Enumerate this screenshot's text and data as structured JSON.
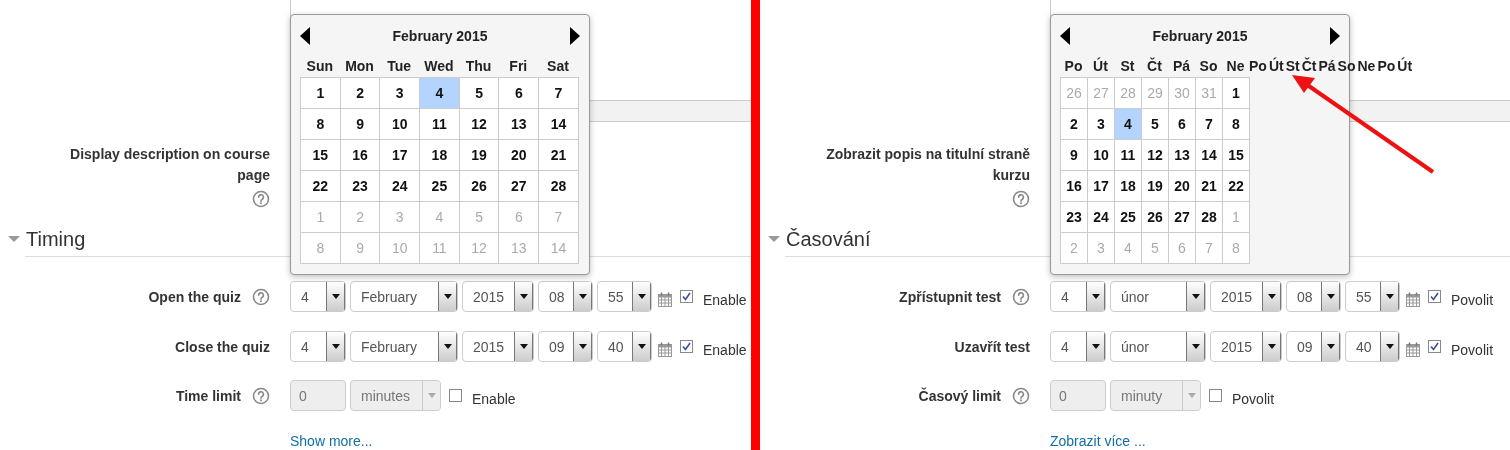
{
  "panels": [
    {
      "calendar": {
        "title": "February 2015",
        "weekdays": [
          "Sun",
          "Mon",
          "Tue",
          "Wed",
          "Thu",
          "Fri",
          "Sat"
        ],
        "weeks": [
          [
            {
              "day": "1",
              "current": true,
              "selected": false
            },
            {
              "day": "2",
              "current": true,
              "selected": false
            },
            {
              "day": "3",
              "current": true,
              "selected": false
            },
            {
              "day": "4",
              "current": true,
              "selected": true
            },
            {
              "day": "5",
              "current": true,
              "selected": false
            },
            {
              "day": "6",
              "current": true,
              "selected": false
            },
            {
              "day": "7",
              "current": true,
              "selected": false
            }
          ],
          [
            {
              "day": "8",
              "current": true,
              "selected": false
            },
            {
              "day": "9",
              "current": true,
              "selected": false
            },
            {
              "day": "10",
              "current": true,
              "selected": false
            },
            {
              "day": "11",
              "current": true,
              "selected": false
            },
            {
              "day": "12",
              "current": true,
              "selected": false
            },
            {
              "day": "13",
              "current": true,
              "selected": false
            },
            {
              "day": "14",
              "current": true,
              "selected": false
            }
          ],
          [
            {
              "day": "15",
              "current": true,
              "selected": false
            },
            {
              "day": "16",
              "current": true,
              "selected": false
            },
            {
              "day": "17",
              "current": true,
              "selected": false
            },
            {
              "day": "18",
              "current": true,
              "selected": false
            },
            {
              "day": "19",
              "current": true,
              "selected": false
            },
            {
              "day": "20",
              "current": true,
              "selected": false
            },
            {
              "day": "21",
              "current": true,
              "selected": false
            }
          ],
          [
            {
              "day": "22",
              "current": true,
              "selected": false
            },
            {
              "day": "23",
              "current": true,
              "selected": false
            },
            {
              "day": "24",
              "current": true,
              "selected": false
            },
            {
              "day": "25",
              "current": true,
              "selected": false
            },
            {
              "day": "26",
              "current": true,
              "selected": false
            },
            {
              "day": "27",
              "current": true,
              "selected": false
            },
            {
              "day": "28",
              "current": true,
              "selected": false
            }
          ],
          [
            {
              "day": "1",
              "current": false,
              "selected": false
            },
            {
              "day": "2",
              "current": false,
              "selected": false
            },
            {
              "day": "3",
              "current": false,
              "selected": false
            },
            {
              "day": "4",
              "current": false,
              "selected": false
            },
            {
              "day": "5",
              "current": false,
              "selected": false
            },
            {
              "day": "6",
              "current": false,
              "selected": false
            },
            {
              "day": "7",
              "current": false,
              "selected": false
            }
          ],
          [
            {
              "day": "8",
              "current": false,
              "selected": false
            },
            {
              "day": "9",
              "current": false,
              "selected": false
            },
            {
              "day": "10",
              "current": false,
              "selected": false
            },
            {
              "day": "11",
              "current": false,
              "selected": false
            },
            {
              "day": "12",
              "current": false,
              "selected": false
            },
            {
              "day": "13",
              "current": false,
              "selected": false
            },
            {
              "day": "14",
              "current": false,
              "selected": false
            }
          ]
        ]
      },
      "description_label": "Display description on course page",
      "section": {
        "title": "Timing",
        "expanded": true
      },
      "date_rows": [
        {
          "label": "Open the quiz",
          "help": true,
          "day": "4",
          "month": "February",
          "year": "2015",
          "hour": "08",
          "minute": "55",
          "enabled": true,
          "enable_label": "Enable"
        },
        {
          "label": "Close the quiz",
          "day": "4",
          "month": "February",
          "year": "2015",
          "hour": "09",
          "minute": "40",
          "enabled": true,
          "enable_label": "Enable"
        }
      ],
      "time_limit": {
        "label": "Time limit",
        "help": true,
        "value": "0",
        "unit": "minutes",
        "enabled": false,
        "enable_label": "Enable"
      },
      "show_more": "Show more..."
    },
    {
      "arrow": true,
      "calendar": {
        "title": "February 2015",
        "weekdays": [
          "Po",
          "Út",
          "St",
          "Čt",
          "Pá",
          "So",
          "Ne"
        ],
        "overflow_weekdays": [
          "Po",
          "Út",
          "St",
          "Čt",
          "Pá",
          "So",
          "Ne",
          "Po",
          "Út"
        ],
        "weeks": [
          [
            {
              "day": "26",
              "current": false,
              "selected": false
            },
            {
              "day": "27",
              "current": false,
              "selected": false
            },
            {
              "day": "28",
              "current": false,
              "selected": false
            },
            {
              "day": "29",
              "current": false,
              "selected": false
            },
            {
              "day": "30",
              "current": false,
              "selected": false
            },
            {
              "day": "31",
              "current": false,
              "selected": false
            },
            {
              "day": "1",
              "current": true,
              "selected": false
            }
          ],
          [
            {
              "day": "2",
              "current": true,
              "selected": false
            },
            {
              "day": "3",
              "current": true,
              "selected": false
            },
            {
              "day": "4",
              "current": true,
              "selected": true
            },
            {
              "day": "5",
              "current": true,
              "selected": false
            },
            {
              "day": "6",
              "current": true,
              "selected": false
            },
            {
              "day": "7",
              "current": true,
              "selected": false
            },
            {
              "day": "8",
              "current": true,
              "selected": false
            }
          ],
          [
            {
              "day": "9",
              "current": true,
              "selected": false
            },
            {
              "day": "10",
              "current": true,
              "selected": false
            },
            {
              "day": "11",
              "current": true,
              "selected": false
            },
            {
              "day": "12",
              "current": true,
              "selected": false
            },
            {
              "day": "13",
              "current": true,
              "selected": false
            },
            {
              "day": "14",
              "current": true,
              "selected": false
            },
            {
              "day": "15",
              "current": true,
              "selected": false
            }
          ],
          [
            {
              "day": "16",
              "current": true,
              "selected": false
            },
            {
              "day": "17",
              "current": true,
              "selected": false
            },
            {
              "day": "18",
              "current": true,
              "selected": false
            },
            {
              "day": "19",
              "current": true,
              "selected": false
            },
            {
              "day": "20",
              "current": true,
              "selected": false
            },
            {
              "day": "21",
              "current": true,
              "selected": false
            },
            {
              "day": "22",
              "current": true,
              "selected": false
            }
          ],
          [
            {
              "day": "23",
              "current": true,
              "selected": false
            },
            {
              "day": "24",
              "current": true,
              "selected": false
            },
            {
              "day": "25",
              "current": true,
              "selected": false
            },
            {
              "day": "26",
              "current": true,
              "selected": false
            },
            {
              "day": "27",
              "current": true,
              "selected": false
            },
            {
              "day": "28",
              "current": true,
              "selected": false
            },
            {
              "day": "1",
              "current": false,
              "selected": false
            }
          ],
          [
            {
              "day": "2",
              "current": false,
              "selected": false
            },
            {
              "day": "3",
              "current": false,
              "selected": false
            },
            {
              "day": "4",
              "current": false,
              "selected": false
            },
            {
              "day": "5",
              "current": false,
              "selected": false
            },
            {
              "day": "6",
              "current": false,
              "selected": false
            },
            {
              "day": "7",
              "current": false,
              "selected": false
            },
            {
              "day": "8",
              "current": false,
              "selected": false
            }
          ]
        ]
      },
      "description_label": "Zobrazit popis na titulní straně kurzu",
      "section": {
        "title": "Časování",
        "expanded": true
      },
      "date_rows": [
        {
          "label": "Zpřístupnit test",
          "help": true,
          "day": "4",
          "month": "únor",
          "year": "2015",
          "hour": "08",
          "minute": "55",
          "enabled": true,
          "enable_label": "Povolit"
        },
        {
          "label": "Uzavřít test",
          "day": "4",
          "month": "únor",
          "year": "2015",
          "hour": "09",
          "minute": "40",
          "enabled": true,
          "enable_label": "Povolit"
        }
      ],
      "time_limit": {
        "label": "Časový limit",
        "help": true,
        "value": "0",
        "unit": "minuty",
        "enabled": false,
        "enable_label": "Povolit"
      },
      "show_more": "Zobrazit více ..."
    }
  ]
}
